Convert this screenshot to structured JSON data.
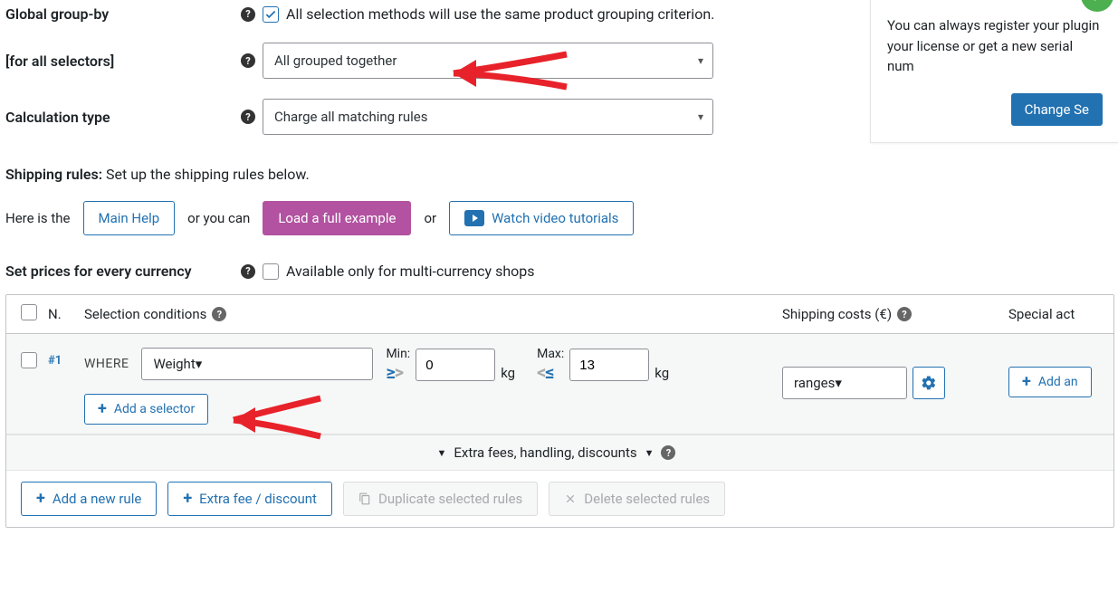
{
  "groupby": {
    "label1": "Global group-by",
    "label2": "[for all selectors]",
    "check_text": "All selection methods will use the same product grouping criterion.",
    "select_value": "All grouped together"
  },
  "calc_type": {
    "label": "Calculation type",
    "select_value": "Charge all matching rules"
  },
  "shipping_rules": {
    "title": "Shipping rules:",
    "subtitle": "Set up the shipping rules below."
  },
  "actions": {
    "here_is": "Here is the",
    "main_help": "Main Help",
    "or_you_can": "or you can",
    "load_example": "Load a full example",
    "or": "or",
    "watch_video": "Watch video tutorials"
  },
  "multi_currency": {
    "label": "Set prices for every currency",
    "check_text": "Available only for multi-currency shops"
  },
  "table": {
    "th_n": "N.",
    "th_sel": "Selection conditions",
    "th_cost": "Shipping costs (€)",
    "th_spec": "Special act"
  },
  "rule1": {
    "n": "#1",
    "where": "WHERE",
    "select_value": "Weight",
    "min_label": "Min:",
    "max_label": "Max:",
    "min_val": "0",
    "max_val": "13",
    "unit": "kg",
    "range_sel": "ranges",
    "add_an": "Add an",
    "add_selector": "Add a selector"
  },
  "extras": "Extra fees, handling, discounts",
  "footer": {
    "add_rule": "Add a new rule",
    "extra_fee": "Extra fee / discount",
    "duplicate": "Duplicate selected rules",
    "delete": "Delete selected rules"
  },
  "side": {
    "text": "You can always register your plugin your license or get a new serial num",
    "button": "Change Se"
  }
}
